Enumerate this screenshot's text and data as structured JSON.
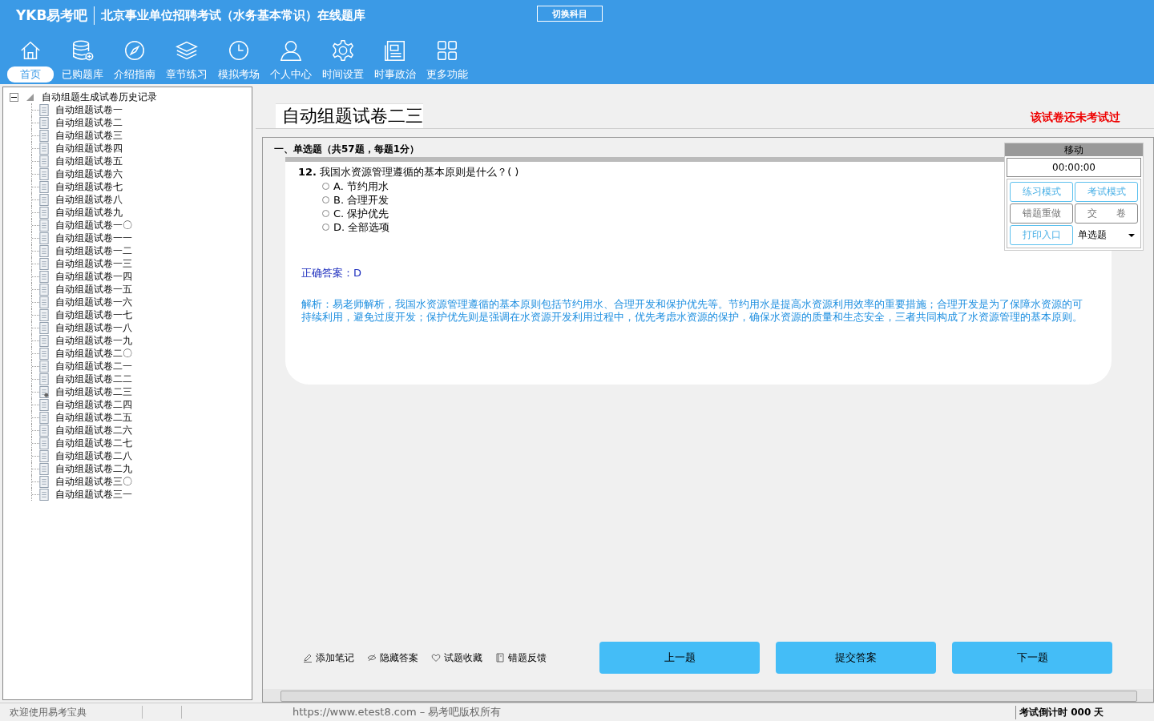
{
  "header": {
    "logo": "YKB易考吧",
    "title": "北京事业单位招聘考试（水务基本常识）在线题库",
    "switch_button": "切换科目"
  },
  "nav": [
    {
      "label": "首页",
      "selected": true
    },
    {
      "label": "已购题库",
      "selected": false
    },
    {
      "label": "介绍指南",
      "selected": false
    },
    {
      "label": "章节练习",
      "selected": false
    },
    {
      "label": "模拟考场",
      "selected": false
    },
    {
      "label": "个人中心",
      "selected": false
    },
    {
      "label": "时间设置",
      "selected": false
    },
    {
      "label": "时事政治",
      "selected": false
    },
    {
      "label": "更多功能",
      "selected": false
    }
  ],
  "tree": {
    "label": "自动组题生成试卷历史记录",
    "expanded": true,
    "children": [
      {
        "label": "自动组题试卷一",
        "selected": false
      },
      {
        "label": "自动组题试卷二",
        "selected": false
      },
      {
        "label": "自动组题试卷三",
        "selected": false
      },
      {
        "label": "自动组题试卷四",
        "selected": false
      },
      {
        "label": "自动组题试卷五",
        "selected": false
      },
      {
        "label": "自动组题试卷六",
        "selected": false
      },
      {
        "label": "自动组题试卷七",
        "selected": false
      },
      {
        "label": "自动组题试卷八",
        "selected": false
      },
      {
        "label": "自动组题试卷九",
        "selected": false
      },
      {
        "label": "自动组题试卷一〇",
        "selected": false
      },
      {
        "label": "自动组题试卷一一",
        "selected": false
      },
      {
        "label": "自动组题试卷一二",
        "selected": false
      },
      {
        "label": "自动组题试卷一三",
        "selected": false
      },
      {
        "label": "自动组题试卷一四",
        "selected": false
      },
      {
        "label": "自动组题试卷一五",
        "selected": false
      },
      {
        "label": "自动组题试卷一六",
        "selected": false
      },
      {
        "label": "自动组题试卷一七",
        "selected": false
      },
      {
        "label": "自动组题试卷一八",
        "selected": false
      },
      {
        "label": "自动组题试卷一九",
        "selected": false
      },
      {
        "label": "自动组题试卷二〇",
        "selected": false
      },
      {
        "label": "自动组题试卷二一",
        "selected": false
      },
      {
        "label": "自动组题试卷二二",
        "selected": false
      },
      {
        "label": "自动组题试卷二三",
        "selected": true
      },
      {
        "label": "自动组题试卷二四",
        "selected": false
      },
      {
        "label": "自动组题试卷二五",
        "selected": false
      },
      {
        "label": "自动组题试卷二六",
        "selected": false
      },
      {
        "label": "自动组题试卷二七",
        "selected": false
      },
      {
        "label": "自动组题试卷二八",
        "selected": false
      },
      {
        "label": "自动组题试卷二九",
        "selected": false
      },
      {
        "label": "自动组题试卷三〇",
        "selected": false
      },
      {
        "label": "自动组题试卷三一",
        "selected": false
      }
    ]
  },
  "paper": {
    "title": "自动组题试卷二三",
    "status": "该试卷还未考试过"
  },
  "section": "一、单选题（共57题，每题1分）",
  "question": {
    "number": "12.",
    "text": "我国水资源管理遵循的基本原则是什么？( )",
    "options": [
      {
        "label": "A. 节约用水",
        "checked": false
      },
      {
        "label": "B. 合理开发",
        "checked": false
      },
      {
        "label": "C. 保护优先",
        "checked": false
      },
      {
        "label": "D. 全部选项",
        "checked": false
      }
    ],
    "answer": "正确答案：D",
    "analysis": "解析：易老师解析，我国水资源管理遵循的基本原则包括节约用水、合理开发和保护优先等。节约用水是提高水资源利用效率的重要措施；合理开发是为了保障水资源的可持续利用，避免过度开发；保护优先则是强调在水资源开发利用过程中，优先考虑水资源的保护，确保水资源的质量和生态安全，三者共同构成了水资源管理的基本原则。"
  },
  "side_panel": {
    "move": "移动",
    "timer": "00:00:00",
    "buttons": [
      {
        "label": "练习模式",
        "kind": "blue"
      },
      {
        "label": "考试模式",
        "kind": "blue"
      },
      {
        "label": "错题重做",
        "kind": "grey"
      },
      {
        "label": "交　　卷",
        "kind": "grey"
      },
      {
        "label": "打印入口",
        "kind": "blue"
      }
    ],
    "type_select": "单选题"
  },
  "tools": [
    {
      "label": "添加笔记"
    },
    {
      "label": "隐藏答案"
    },
    {
      "label": "试题收藏"
    },
    {
      "label": "错题反馈"
    }
  ],
  "actions": [
    "上一题",
    "提交答案",
    "下一题"
  ],
  "status_bar": {
    "welcome": "欢迎使用易考宝典",
    "copyright": "https://www.etest8.com – 易考吧版权所有",
    "countdown": "考试倒计时 000 天"
  }
}
